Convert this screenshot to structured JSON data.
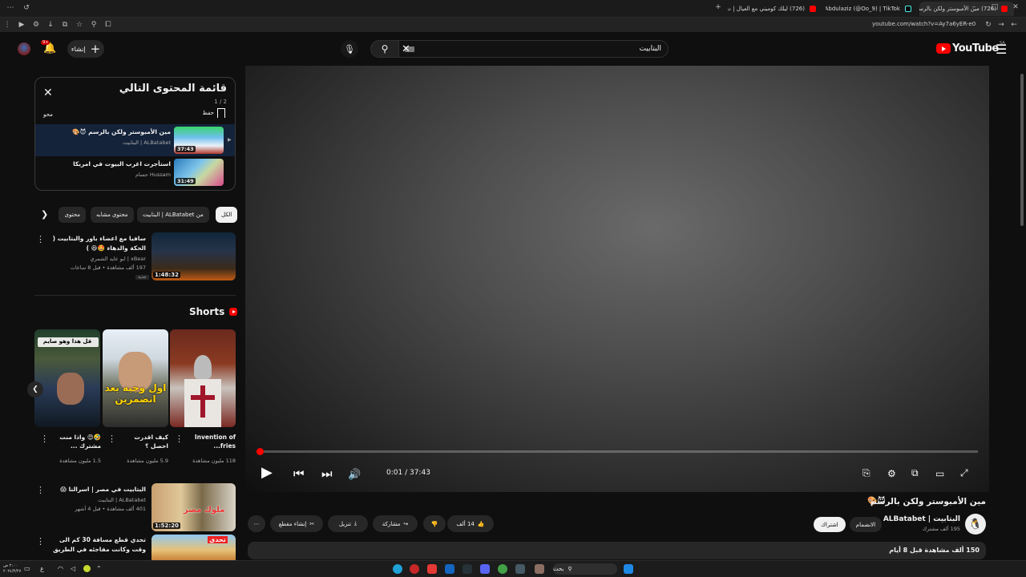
{
  "browser": {
    "tabs": [
      {
        "title": "(726) مين الأمبوستر ولكن بالرسم"
      },
      {
        "title": "Abdulaziz (@Oo_9) | TikTok"
      },
      {
        "title": "(726) ليلك كوميني مع العيال | ت"
      }
    ],
    "url": "youtube.com/watch?v=Ay7a6yER-e0"
  },
  "header": {
    "logo": "YouTube",
    "country": "SA",
    "search_query": "البتابيت",
    "create_label": "إنشاء",
    "notification_count": "9+"
  },
  "player": {
    "current_time": "0:01",
    "duration": "37:43",
    "progress_fraction": 0.0004
  },
  "video": {
    "title": "مين الأمبوستر ولكن بالرسم",
    "channel": "البتابيت | ALBatabet",
    "subscribers": "195 ألف مشترك",
    "join_label": "الانضمام",
    "subscribe_label": "اشتراك",
    "likes": "14 ألف",
    "share_label": "مشاركة",
    "download_label": "تنزيل",
    "clip_label": "إنشاء مقطع",
    "stats": "150 ألف مشاهدة قبل 8 أيام"
  },
  "playlist": {
    "title": "قائمة المحتوى التالي",
    "position": "1 / 2",
    "save_label": "حفظ",
    "clear_label": "محو",
    "items": [
      {
        "title": "مين الأمبوستر ولكن بالرسم",
        "channel": "ALBatabet | البتابيت",
        "duration": "37:43"
      },
      {
        "title": "استأجرت اغرب البيوت في امريكا",
        "channel": "Hussam حسام",
        "duration": "31:49"
      }
    ]
  },
  "chips": [
    "الكل",
    "من ALBatabet | البتابيت",
    "محتوى مشابه",
    "محتوى"
  ],
  "recommendations": [
    {
      "title": "سافيا مع اعضاء باور والبتابيت ( الحكة والدهاء",
      "channel": "xBear | ابو عايد الشمري",
      "meta": "197 ألف مشاهدة • قبل 8 ساعات",
      "badge": "جديد",
      "duration": "1:48:32"
    },
    {
      "title": "البتابيت في مصر | اسرالنا",
      "channel": "ALBatabet | البتابيت",
      "meta": "401 ألف مشاهدة • قبل 4 أشهر",
      "duration": "1:52:20"
    },
    {
      "title": "تحدي قطع مسافة 30 كم الى وقت وكانت مفاجئه في الطريق",
      "channel": "",
      "meta": "",
      "duration": ""
    }
  ],
  "shorts": {
    "heading": "Shorts",
    "items": [
      {
        "title": "Invention of fries...",
        "views": "118 مليون مشاهدة"
      },
      {
        "title": "كيف اقدرت احصل ؟",
        "views": "5.9 مليون مشاهدة",
        "caption": "اول وجبه بعد انضمرين"
      },
      {
        "title": "واذا منت مشترك ...",
        "views": "1.5 مليون مشاهدة",
        "caption": "قل هذا وهو صايم"
      }
    ]
  },
  "taskbar": {
    "search_label": "بحث",
    "clock": "٢:٠٠ ص",
    "date": "٢٠٢٤/٣/٢٧"
  }
}
